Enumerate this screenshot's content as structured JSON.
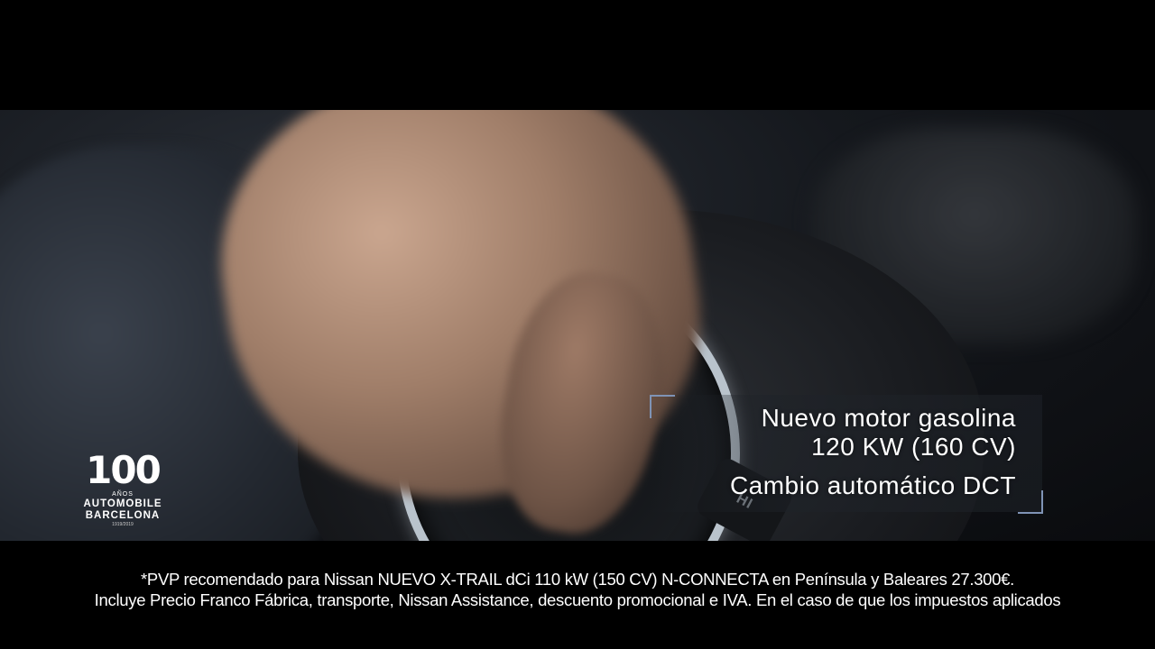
{
  "logo": {
    "number": "100",
    "line1": "AÑOS",
    "line2": "AUTOMOBILE",
    "line3": "BARCELONA",
    "years": "1919/2019"
  },
  "scene": {
    "button_label": "HI"
  },
  "specs": {
    "line1": "Nuevo motor gasolina",
    "line2": "120 KW (160 CV)",
    "line3": "Cambio automático DCT",
    "bracket_color": "#7f93b5"
  },
  "disclaimer": {
    "line1": "*PVP recomendado para Nissan NUEVO X-TRAIL  dCi 110 kW (150 CV) N-CONNECTA en Península y Baleares 27.300€.",
    "line2": "Incluye Precio Franco Fábrica, transporte, Nissan Assistance, descuento promocional e IVA. En el caso de que los impuestos aplicados"
  }
}
